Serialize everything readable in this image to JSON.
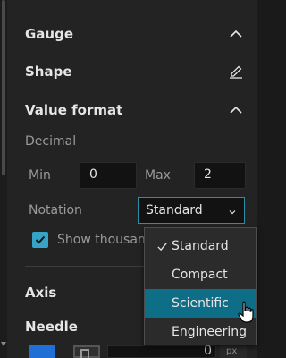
{
  "panel": {
    "sections": {
      "gauge": {
        "label": "Gauge"
      },
      "shape": {
        "label": "Shape"
      },
      "value_format": {
        "label": "Value format"
      },
      "axis": {
        "label": "Axis"
      },
      "needle": {
        "label": "Needle"
      }
    },
    "decimal": {
      "label": "Decimal",
      "min_label": "Min",
      "min_value": "0",
      "max_label": "Max",
      "max_value": "2"
    },
    "notation": {
      "label": "Notation",
      "selected": "Standard",
      "options": [
        "Standard",
        "Compact",
        "Scientific",
        "Engineering"
      ],
      "checked_option": "Standard",
      "hovered_option": "Scientific"
    },
    "show_thousands": {
      "label": "Show thousan",
      "checked": true
    },
    "needle_row": {
      "value": "0",
      "unit": "px"
    }
  },
  "colors": {
    "accent": "#35a4c6",
    "hover": "#0e6d87",
    "swatch": "#1f6fd6"
  },
  "icons": {
    "gauge_toggle": "chevron-up-icon",
    "shape_edit": "pencil-icon",
    "value_format_toggle": "chevron-up-icon",
    "select_caret": "chevron-down-icon",
    "checkmark": "check-icon",
    "cursor": "hand-pointer-icon"
  }
}
